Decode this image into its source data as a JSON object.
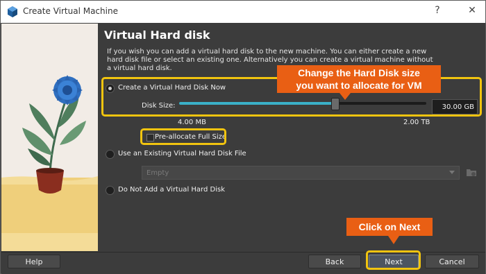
{
  "window": {
    "title": "Create Virtual Machine",
    "help_glyph": "?",
    "close_glyph": "✕"
  },
  "page": {
    "heading": "Virtual Hard disk",
    "description": "If you wish you can add a virtual hard disk to the new machine. You can either create a new hard disk file or select an existing one. Alternatively you can create a virtual machine without a virtual hard disk."
  },
  "options": {
    "create_new": {
      "label": "Create a Virtual Hard Disk Now",
      "selected": true
    },
    "disk_size": {
      "label": "Disk Size:",
      "value": "30.00 GB",
      "min_label": "4.00 MB",
      "max_label": "2.00 TB",
      "slider_position": 0.63
    },
    "preallocate": {
      "label": "Pre-allocate Full Size",
      "checked": false
    },
    "use_existing": {
      "label": "Use an Existing Virtual Hard Disk File",
      "selected": false,
      "combo_value": "Empty"
    },
    "no_disk": {
      "label": "Do Not Add a Virtual Hard Disk",
      "selected": false
    }
  },
  "buttons": {
    "help": "Help",
    "back": "Back",
    "next": "Next",
    "cancel": "Cancel"
  },
  "annotations": {
    "size_callout_line1": "Change the Hard Disk size",
    "size_callout_line2": "you want to allocate for VM",
    "next_callout": "Click on Next",
    "accent_color": "#e95f14",
    "highlight_color": "#f1c40f"
  },
  "icons": {
    "app": "virtualbox-cube-icon",
    "folder": "folder-browse-icon"
  }
}
